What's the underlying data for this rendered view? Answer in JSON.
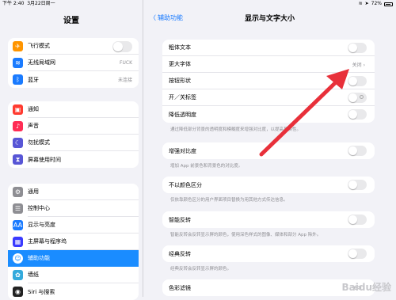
{
  "status_bar": {
    "time": "下午 2:40",
    "date": "3月22日周一",
    "battery": "72%"
  },
  "sidebar": {
    "title": "设置",
    "group1": [
      {
        "label": "飞行模式",
        "icon": "airplane-icon",
        "color": "#ff9500",
        "glyph": "✈"
      },
      {
        "label": "无线局域网",
        "icon": "wifi-icon",
        "color": "#1a7bff",
        "glyph": "≋",
        "value": "FUCK"
      },
      {
        "label": "蓝牙",
        "icon": "bluetooth-icon",
        "color": "#1a7bff",
        "glyph": "ᛒ",
        "value": "未连接"
      }
    ],
    "group2": [
      {
        "label": "通知",
        "icon": "notifications-icon",
        "color": "#ff3b30",
        "glyph": "▣"
      },
      {
        "label": "声音",
        "icon": "sound-icon",
        "color": "#ff2d55",
        "glyph": "♪"
      },
      {
        "label": "勿扰模式",
        "icon": "moon-icon",
        "color": "#5856d6",
        "glyph": "☾"
      },
      {
        "label": "屏幕使用时间",
        "icon": "hourglass-icon",
        "color": "#5856d6",
        "glyph": "⧗"
      }
    ],
    "group3": [
      {
        "label": "通用",
        "icon": "gear-icon",
        "color": "#8e8e93",
        "glyph": "⚙"
      },
      {
        "label": "控制中心",
        "icon": "control-center-icon",
        "color": "#8e8e93",
        "glyph": "☰"
      },
      {
        "label": "显示与亮度",
        "icon": "display-icon",
        "color": "#1a7bff",
        "glyph": "AA"
      },
      {
        "label": "主屏幕与程序坞",
        "icon": "home-screen-icon",
        "color": "#3a3aff",
        "glyph": "▦"
      },
      {
        "label": "辅助功能",
        "icon": "accessibility-icon",
        "color": "#1a7bff",
        "glyph": "☺",
        "selected": true
      },
      {
        "label": "墙纸",
        "icon": "wallpaper-icon",
        "color": "#34aadc",
        "glyph": "✿"
      },
      {
        "label": "Siri 与搜索",
        "icon": "siri-icon",
        "color": "#222222",
        "glyph": "◉"
      }
    ]
  },
  "main": {
    "back_label": "辅助功能",
    "title": "显示与文字大小",
    "group1": [
      {
        "label": "粗体文本",
        "kind": "toggle"
      },
      {
        "label": "更大字体",
        "kind": "value",
        "value": "关闭"
      },
      {
        "label": "按钮形状",
        "kind": "toggle"
      },
      {
        "label": "开／关标签",
        "kind": "onoff"
      },
      {
        "label": "降低透明度",
        "kind": "toggle"
      }
    ],
    "desc1": "通过降低部分背景的透明度和模糊度来增强对比度，以提高易读性。",
    "group2": [
      {
        "label": "增强对比度",
        "kind": "toggle"
      }
    ],
    "desc2": "增加 App 前景色和背景色的对比度。",
    "group3": [
      {
        "label": "不以颜色区分",
        "kind": "toggle"
      }
    ],
    "desc3": "仅依靠颜色区分的用户界面项目替换为用其他方式传达信息。",
    "group4": [
      {
        "label": "智能反转",
        "kind": "toggle"
      }
    ],
    "desc4": "智能反转会反转显示屏的颜色，使用深色样式的图像、媒体和部分 App 除外。",
    "group5": [
      {
        "label": "经典反转",
        "kind": "toggle"
      }
    ],
    "desc5": "经典反转会反转显示屏的颜色。",
    "group6": [
      {
        "label": "色彩滤镜",
        "kind": "value",
        "value": "关闭"
      }
    ]
  },
  "annotation": {
    "color": "#e8303a"
  },
  "watermark": "Baidu经验"
}
